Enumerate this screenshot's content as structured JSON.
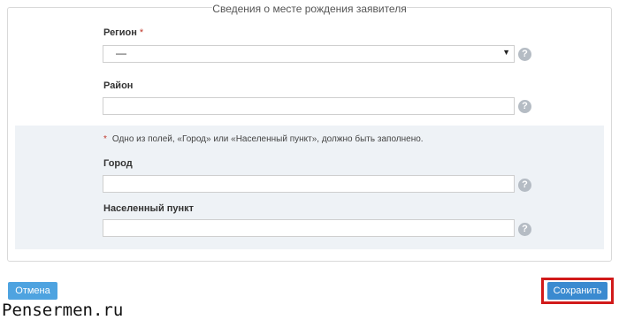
{
  "form": {
    "legend": "Сведения о месте рождения заявителя",
    "region": {
      "label": "Регион",
      "required_mark": "*",
      "value": "—"
    },
    "district": {
      "label": "Район",
      "value": ""
    },
    "note": {
      "mark": "*",
      "text": "Одно из полей, «Город» или «Населенный пункт», должно быть заполнено."
    },
    "city": {
      "label": "Город",
      "value": ""
    },
    "settlement": {
      "label": "Населенный пункт",
      "value": ""
    },
    "help_glyph": "?",
    "caret_glyph": "▼"
  },
  "actions": {
    "cancel_label": "Отмена",
    "save_label": "Сохранить"
  },
  "watermark": "Pensermen.ru",
  "colors": {
    "accent": "#3a8ad0",
    "highlight": "#d11a1a",
    "required": "#c0392b",
    "group_bg": "#eef2f6"
  }
}
